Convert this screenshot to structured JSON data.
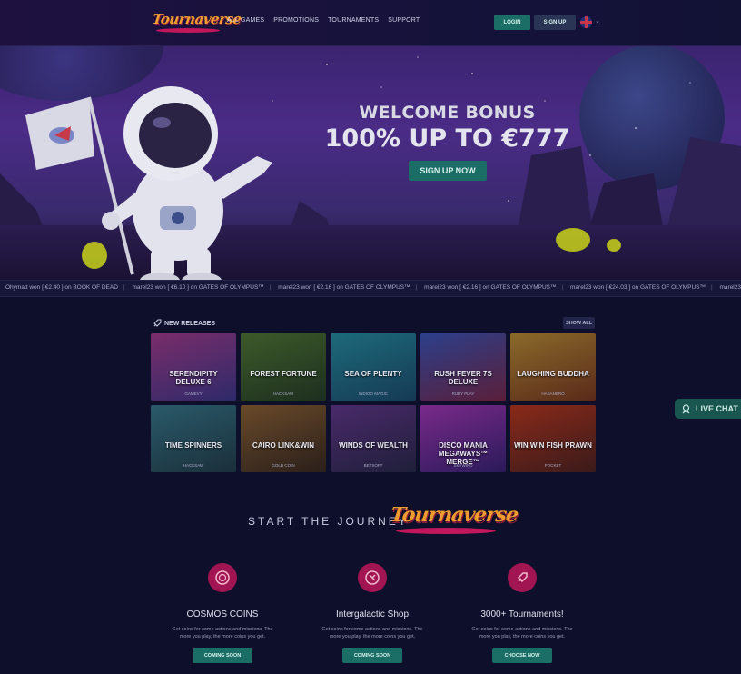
{
  "header": {
    "logo_text": "Tournaverse",
    "nav": [
      "ALL GAMES",
      "PROMOTIONS",
      "TOURNAMENTS",
      "SUPPORT"
    ],
    "login_label": "LOGIN",
    "signup_label": "SIGN UP",
    "language_icon": "uk-flag-icon"
  },
  "hero": {
    "line1": "WELCOME BONUS",
    "line2": "100% UP TO €777",
    "cta": "SIGN UP NOW"
  },
  "ticker": [
    "Ohymatt won [ €2.40 ] on BOOK OF DEAD",
    "marel23 won [ €6.10 ] on GATES OF OLYMPUS™",
    "marel23 won [ €2.16 ] on GATES OF OLYMPUS™",
    "marel23 won [ €2.16 ] on GATES OF OLYMPUS™",
    "marel23 won [ €24.03 ] on GATES OF OLYMPUS™",
    "marel23"
  ],
  "new_releases": {
    "title": "NEW RELEASES",
    "show_all": "SHOW ALL",
    "games": [
      {
        "title": "SERENDIPITY DELUXE 6",
        "provider": "GAMEVY",
        "color1": "#7a2d6a",
        "color2": "#2e2a6a"
      },
      {
        "title": "FOREST FORTUNE",
        "provider": "HACKSAW",
        "color1": "#3d5a2a",
        "color2": "#1d2f1f"
      },
      {
        "title": "SEA OF PLENTY",
        "provider": "INDIGO MAGIC",
        "color1": "#1d6a7a",
        "color2": "#163a56"
      },
      {
        "title": "RUSH FEVER 7S DELUXE",
        "provider": "RUBY PLAY",
        "color1": "#2c3f8a",
        "color2": "#5a1f3a"
      },
      {
        "title": "LAUGHING BUDDHA",
        "provider": "HABANERO",
        "color1": "#8a6a2a",
        "color2": "#5a2a1a"
      },
      {
        "title": "TIME SPINNERS",
        "provider": "HACKSAW",
        "color1": "#2a5a6a",
        "color2": "#1a2f3a"
      },
      {
        "title": "CAIRO LINK&WIN",
        "provider": "GOLD COIN",
        "color1": "#6a4a2a",
        "color2": "#2a1f1a"
      },
      {
        "title": "WINDS OF WEALTH",
        "provider": "BETSOFT",
        "color1": "#4a2a6a",
        "color2": "#1f1f3a"
      },
      {
        "title": "DISCO MANIA MEGAWAYS™ MERGE™",
        "provider": "SKYWIND",
        "color1": "#7a2a8a",
        "color2": "#2a1a5a"
      },
      {
        "title": "WIN WIN FISH PRAWN",
        "provider": "POCKET",
        "color1": "#8a2a1a",
        "color2": "#3a1a1a"
      }
    ]
  },
  "live_chat": "LIVE CHAT",
  "journey": {
    "title": "START THE JOURNEY",
    "logo_text": "Tournaverse",
    "features": [
      {
        "title": "COSMOS COINS",
        "desc": "Get coins for some actions and missions. The more you play, the more coins you get.",
        "button": "COMING SOON",
        "icon": "coin-icon"
      },
      {
        "title": "Intergalactic Shop",
        "desc": "Get coins for some actions and missions. The more you play, the more coins you get.",
        "button": "COMING SOON",
        "icon": "shop-icon"
      },
      {
        "title": "3000+ Tournaments!",
        "desc": "Get coins for some actions and missions. The more you play, the more coins you get.",
        "button": "CHOOSE NOW",
        "icon": "rocket-icon"
      }
    ]
  },
  "colors": {
    "accent_teal": "#1b6e66",
    "brand_pink": "#a01552",
    "brand_orange": "#f0a033"
  }
}
